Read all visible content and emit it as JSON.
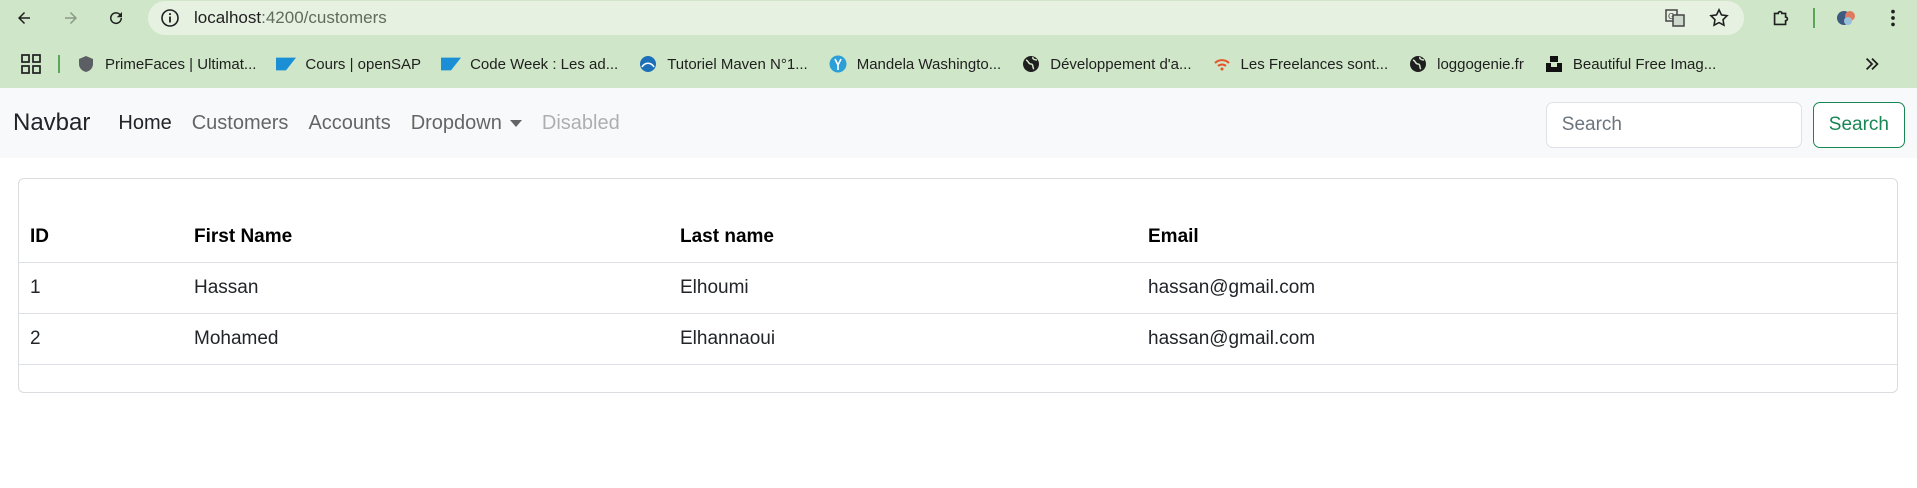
{
  "browser": {
    "url_host": "localhost",
    "url_path": ":4200/customers",
    "bookmarks": [
      {
        "label": "PrimeFaces | Ultimat...",
        "icon": "primefaces-icon"
      },
      {
        "label": "Cours | openSAP",
        "icon": "sap-icon"
      },
      {
        "label": "Code Week : Les ad...",
        "icon": "sap-icon"
      },
      {
        "label": "Tutoriel Maven N°1...",
        "icon": "maven-icon"
      },
      {
        "label": "Mandela Washingto...",
        "icon": "yali-icon"
      },
      {
        "label": "Développement d'a...",
        "icon": "globe-icon"
      },
      {
        "label": "Les Freelances sont...",
        "icon": "wifi-icon"
      },
      {
        "label": "loggogenie.fr",
        "icon": "globe-icon"
      },
      {
        "label": "Beautiful Free Imag...",
        "icon": "unsplash-icon"
      }
    ]
  },
  "navbar": {
    "brand": "Navbar",
    "links": {
      "home": "Home",
      "customers": "Customers",
      "accounts": "Accounts",
      "dropdown": "Dropdown",
      "disabled": "Disabled"
    },
    "search_placeholder": "Search",
    "search_button": "Search"
  },
  "table": {
    "columns": [
      "ID",
      "First Name",
      "Last name",
      "Email"
    ],
    "rows": [
      [
        "1",
        "Hassan",
        "Elhoumi",
        "hassan@gmail.com"
      ],
      [
        "2",
        "Mohamed",
        "Elhannaoui",
        "hassan@gmail.com"
      ]
    ]
  },
  "colors": {
    "chrome_bg": "#cfe6c8",
    "navbar_bg": "#f8f9fa",
    "success": "#198754"
  }
}
